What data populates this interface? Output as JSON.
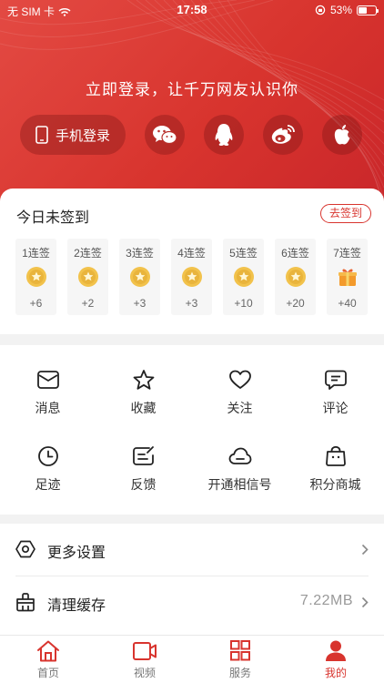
{
  "status_bar": {
    "carrier": "无 SIM 卡",
    "time": "17:58",
    "battery": "53%",
    "battery_level": 0.53
  },
  "header": {
    "login_prompt": "立即登录，让千万网友认识你",
    "phone_login_label": "手机登录",
    "social_icons": [
      "wechat-icon",
      "qq-icon",
      "weibo-icon",
      "apple-icon"
    ]
  },
  "signin": {
    "title": "今日未签到",
    "button_label": "去签到",
    "days": [
      {
        "label": "1连签",
        "points": "+6",
        "icon": "coin-icon"
      },
      {
        "label": "2连签",
        "points": "+2",
        "icon": "coin-icon"
      },
      {
        "label": "3连签",
        "points": "+3",
        "icon": "coin-icon"
      },
      {
        "label": "4连签",
        "points": "+3",
        "icon": "coin-icon"
      },
      {
        "label": "5连签",
        "points": "+10",
        "icon": "coin-icon"
      },
      {
        "label": "6连签",
        "points": "+20",
        "icon": "coin-icon"
      },
      {
        "label": "7连签",
        "points": "+40",
        "icon": "gift-icon"
      }
    ]
  },
  "grid": {
    "items": [
      {
        "label": "消息",
        "icon": "message-icon"
      },
      {
        "label": "收藏",
        "icon": "star-icon"
      },
      {
        "label": "关注",
        "icon": "heart-icon"
      },
      {
        "label": "评论",
        "icon": "comment-icon"
      },
      {
        "label": "足迹",
        "icon": "clock-icon"
      },
      {
        "label": "反馈",
        "icon": "feedback-icon"
      },
      {
        "label": "开通相信号",
        "icon": "cloud-icon"
      },
      {
        "label": "积分商城",
        "icon": "shopping-bag-icon"
      }
    ]
  },
  "settings": {
    "more_settings_label": "更多设置",
    "clear_cache_label": "清理缓存",
    "cache_size": "7.22MB"
  },
  "tabbar": {
    "tabs": [
      {
        "label": "首页",
        "icon": "home-icon"
      },
      {
        "label": "视频",
        "icon": "video-icon"
      },
      {
        "label": "服务",
        "icon": "grid-icon"
      },
      {
        "label": "我的",
        "icon": "user-icon",
        "active": true
      }
    ]
  },
  "colors": {
    "brand_red": "#d8342e",
    "coin_gold": "#e9b43c"
  }
}
